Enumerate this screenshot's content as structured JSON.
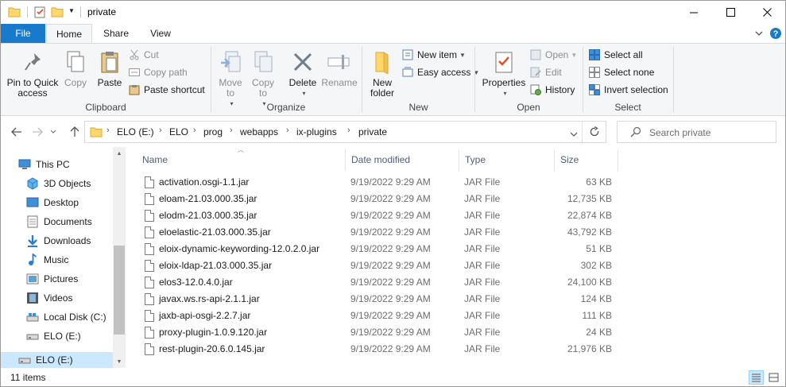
{
  "window": {
    "title": "private"
  },
  "tabs": {
    "file": "File",
    "home": "Home",
    "share": "Share",
    "view": "View"
  },
  "ribbon": {
    "clipboard": {
      "label": "Clipboard",
      "pin": "Pin to Quick access",
      "copy": "Copy",
      "paste": "Paste",
      "cut": "Cut",
      "copy_path": "Copy path",
      "paste_shortcut": "Paste shortcut"
    },
    "organize": {
      "label": "Organize",
      "move_to": "Move to",
      "copy_to": "Copy to",
      "delete": "Delete",
      "rename": "Rename"
    },
    "new": {
      "label": "New",
      "new_folder": "New folder",
      "new_item": "New item",
      "easy_access": "Easy access"
    },
    "open": {
      "label": "Open",
      "properties": "Properties",
      "open": "Open",
      "edit": "Edit",
      "history": "History"
    },
    "select": {
      "label": "Select",
      "select_all": "Select all",
      "select_none": "Select none",
      "invert_selection": "Invert selection"
    }
  },
  "address": {
    "crumbs": [
      "ELO (E:)",
      "ELO",
      "prog",
      "webapps",
      "ix-plugins",
      "private"
    ]
  },
  "search": {
    "placeholder": "Search private"
  },
  "nav": {
    "items": [
      {
        "label": "This PC",
        "icon": "pc-icon"
      },
      {
        "label": "3D Objects",
        "icon": "3d-objects-icon"
      },
      {
        "label": "Desktop",
        "icon": "desktop-icon"
      },
      {
        "label": "Documents",
        "icon": "documents-icon"
      },
      {
        "label": "Downloads",
        "icon": "downloads-icon"
      },
      {
        "label": "Music",
        "icon": "music-icon"
      },
      {
        "label": "Pictures",
        "icon": "pictures-icon"
      },
      {
        "label": "Videos",
        "icon": "videos-icon"
      },
      {
        "label": "Local Disk (C:)",
        "icon": "drive-icon"
      },
      {
        "label": "ELO (E:)",
        "icon": "drive-icon"
      },
      {
        "label": "ELO (E:)",
        "icon": "drive-icon"
      }
    ]
  },
  "columns": {
    "name": "Name",
    "date": "Date modified",
    "type": "Type",
    "size": "Size"
  },
  "files": [
    {
      "name": "activation.osgi-1.1.jar",
      "date": "9/19/2022 9:29 AM",
      "type": "JAR File",
      "size": "63 KB"
    },
    {
      "name": "eloam-21.03.000.35.jar",
      "date": "9/19/2022 9:29 AM",
      "type": "JAR File",
      "size": "12,735 KB"
    },
    {
      "name": "elodm-21.03.000.35.jar",
      "date": "9/19/2022 9:29 AM",
      "type": "JAR File",
      "size": "22,874 KB"
    },
    {
      "name": "eloelastic-21.03.000.35.jar",
      "date": "9/19/2022 9:29 AM",
      "type": "JAR File",
      "size": "43,792 KB"
    },
    {
      "name": "eloix-dynamic-keywording-12.0.2.0.jar",
      "date": "9/19/2022 9:29 AM",
      "type": "JAR File",
      "size": "51 KB"
    },
    {
      "name": "eloix-ldap-21.03.000.35.jar",
      "date": "9/19/2022 9:29 AM",
      "type": "JAR File",
      "size": "302 KB"
    },
    {
      "name": "elos3-12.0.4.0.jar",
      "date": "9/19/2022 9:29 AM",
      "type": "JAR File",
      "size": "24,100 KB"
    },
    {
      "name": "javax.ws.rs-api-2.1.1.jar",
      "date": "9/19/2022 9:29 AM",
      "type": "JAR File",
      "size": "124 KB"
    },
    {
      "name": "jaxb-api-osgi-2.2.7.jar",
      "date": "9/19/2022 9:29 AM",
      "type": "JAR File",
      "size": "111 KB"
    },
    {
      "name": "proxy-plugin-1.0.9.120.jar",
      "date": "9/19/2022 9:29 AM",
      "type": "JAR File",
      "size": "24 KB"
    },
    {
      "name": "rest-plugin-20.6.0.145.jar",
      "date": "9/19/2022 9:29 AM",
      "type": "JAR File",
      "size": "21,976 KB"
    }
  ],
  "status": {
    "count": "11 items"
  },
  "colors": {
    "file_tab": "#1979ca",
    "ribbon_bg": "#f5f6f7",
    "selected_nav": "#cce8ff",
    "folder": "#ffd76a",
    "header_text": "#4c607a"
  }
}
